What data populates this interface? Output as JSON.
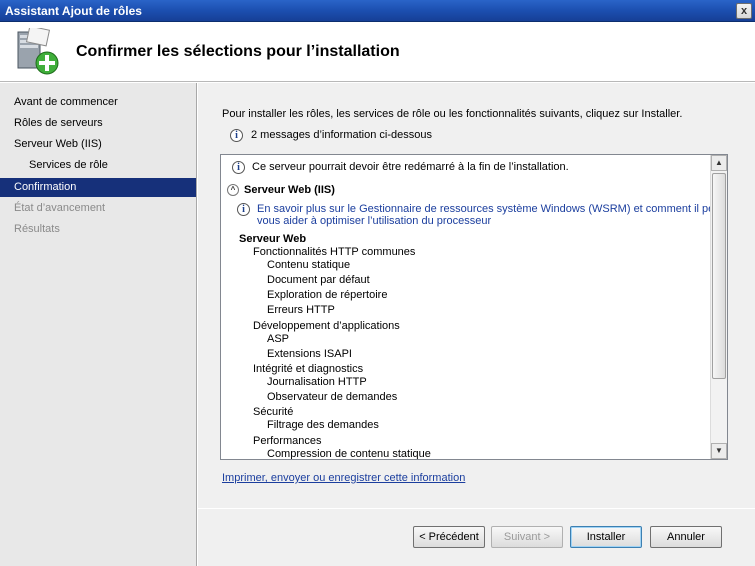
{
  "window": {
    "title": "Assistant Ajout de rôles",
    "close_glyph": "x"
  },
  "header": {
    "title": "Confirmer les sélections pour l’installation",
    "icon": "server-add-icon"
  },
  "sidebar": {
    "items": [
      {
        "label": "Avant de commencer",
        "state": "normal"
      },
      {
        "label": "Rôles de serveurs",
        "state": "normal"
      },
      {
        "label": "Serveur Web (IIS)",
        "state": "normal"
      },
      {
        "label": "Services de rôle",
        "state": "sub"
      },
      {
        "label": "Confirmation",
        "state": "active"
      },
      {
        "label": "État d’avancement",
        "state": "disabled"
      },
      {
        "label": "Résultats",
        "state": "disabled"
      }
    ]
  },
  "main": {
    "intro": "Pour installer les rôles, les services de rôle ou les fonctionnalités suivants, cliquez sur Installer.",
    "info_count": "2 messages d’information ci-dessous",
    "restart_message": "Ce serveur pourrait devoir être redémarré à la fin de l’installation.",
    "section_title": "Serveur Web (IIS)",
    "wsrm_line1": "En savoir plus sur le Gestionnaire de ressources système Windows (WSRM) et comment il peut",
    "wsrm_line2": "vous aider à optimiser l’utilisation du processeur",
    "features": [
      {
        "text": "Serveur Web",
        "level": 0
      },
      {
        "text": "Fonctionnalités HTTP communes",
        "level": 1
      },
      {
        "text": "Contenu statique",
        "level": 2
      },
      {
        "text": "Document par défaut",
        "level": 2
      },
      {
        "text": "Exploration de répertoire",
        "level": 2
      },
      {
        "text": "Erreurs HTTP",
        "level": 2
      },
      {
        "text": "Développement d’applications",
        "level": 1
      },
      {
        "text": "ASP",
        "level": 2
      },
      {
        "text": "Extensions ISAPI",
        "level": 2
      },
      {
        "text": "Intégrité et diagnostics",
        "level": 1
      },
      {
        "text": "Journalisation HTTP",
        "level": 2
      },
      {
        "text": "Observateur de demandes",
        "level": 2
      },
      {
        "text": "Sécurité",
        "level": 1
      },
      {
        "text": "Filtrage des demandes",
        "level": 2
      },
      {
        "text": "Performances",
        "level": 1
      },
      {
        "text": "Compression de contenu statique",
        "level": 2
      }
    ],
    "print_link": "Imprimer, envoyer ou enregistrer cette information"
  },
  "buttons": {
    "previous": "< Précédent",
    "next": "Suivant >",
    "install": "Installer",
    "cancel": "Annuler"
  },
  "icons": {
    "info": "i",
    "collapse": "^",
    "scroll_up": "▲",
    "scroll_down": "▼"
  },
  "colors": {
    "accent": "#16307a",
    "link": "#1b3e9e",
    "titlebar": "#1c4fb0"
  }
}
